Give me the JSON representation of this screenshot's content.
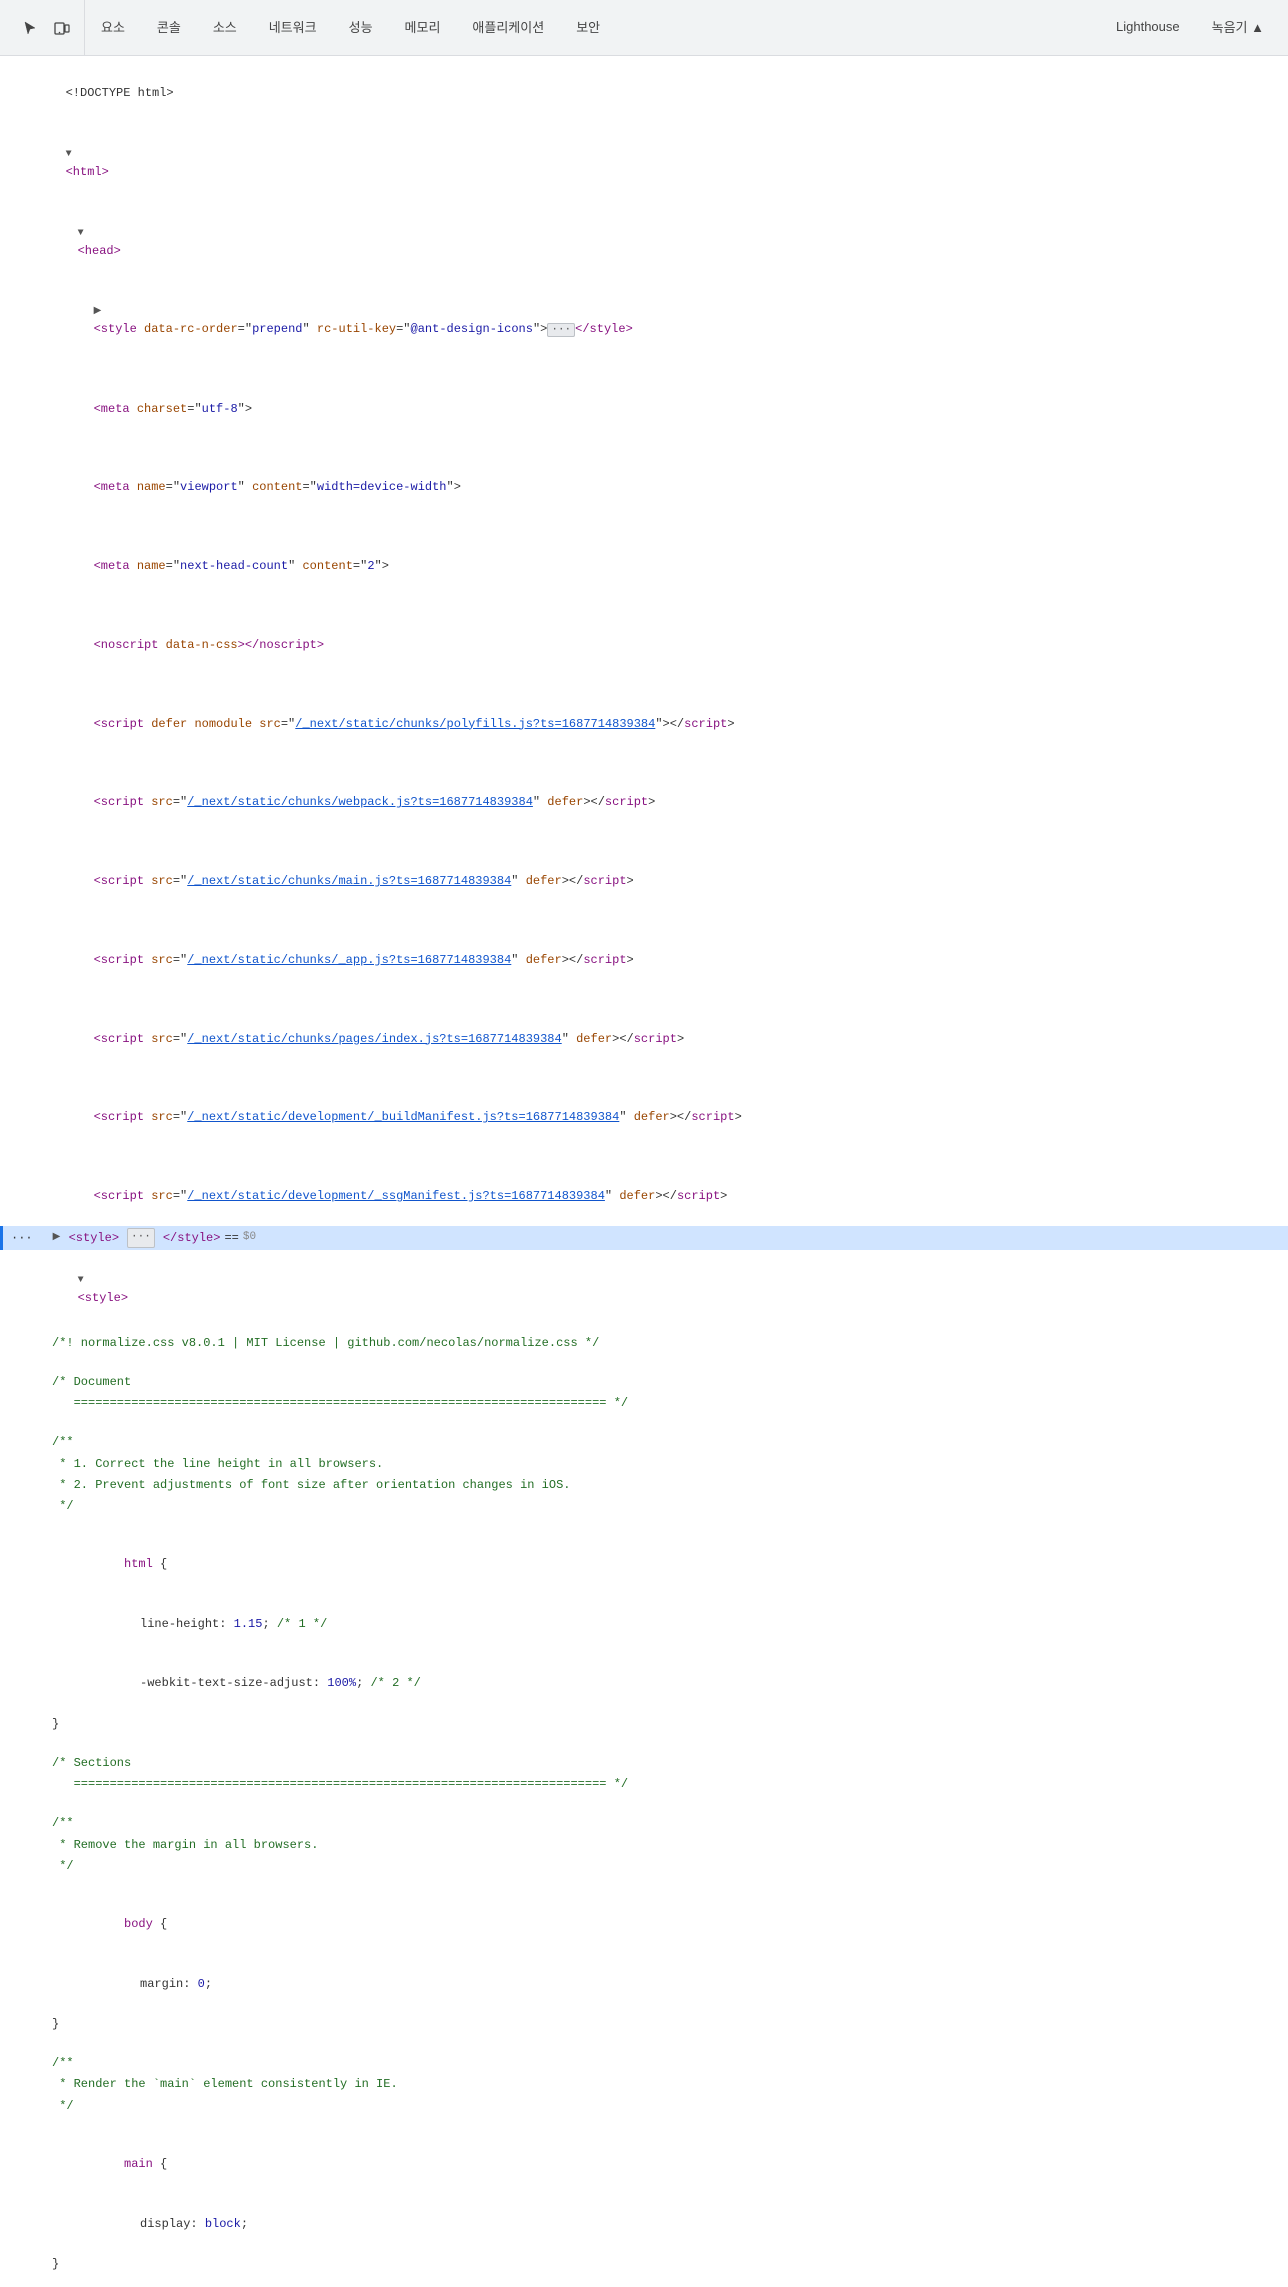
{
  "toolbar": {
    "icons": [
      {
        "name": "cursor-icon",
        "symbol": "↖",
        "label": "Inspect element"
      },
      {
        "name": "device-icon",
        "symbol": "⬜",
        "label": "Toggle device toolbar"
      }
    ],
    "tabs": [
      {
        "id": "elements",
        "label": "요소",
        "active": false
      },
      {
        "id": "console",
        "label": "콘솔",
        "active": false
      },
      {
        "id": "sources",
        "label": "소스",
        "active": false
      },
      {
        "id": "network",
        "label": "네트워크",
        "active": false
      },
      {
        "id": "performance",
        "label": "성능",
        "active": false
      },
      {
        "id": "memory",
        "label": "메모리",
        "active": false
      },
      {
        "id": "application",
        "label": "애플리케이션",
        "active": false
      },
      {
        "id": "security",
        "label": "보안",
        "active": false
      },
      {
        "id": "lighthouse",
        "label": "Lighthouse",
        "active": false
      },
      {
        "id": "record",
        "label": "녹음기 ▲",
        "active": false
      }
    ]
  },
  "dom": {
    "lines": [
      {
        "text": "<!DOCTYPE html>",
        "type": "plain",
        "indent": 0
      },
      {
        "text": "<html>",
        "type": "tag-open",
        "indent": 0
      },
      {
        "text": "<head>",
        "type": "tag-open-expand",
        "indent": 0,
        "expanded": true
      },
      {
        "text": "<style data-rc-order=\"prepend\" rc-util-key=\"@ant-design-icons\">",
        "type": "style-collapsed",
        "indent": 1
      },
      {
        "text": "<meta charset=\"utf-8\">",
        "type": "meta",
        "indent": 1
      },
      {
        "text": "<meta name=\"viewport\" content=\"width=device-width\">",
        "type": "meta",
        "indent": 1
      },
      {
        "text": "<meta name=\"next-head-count\" content=\"2\">",
        "type": "meta",
        "indent": 1
      },
      {
        "text": "<noscript data-n-css></noscript>",
        "type": "noscript",
        "indent": 1
      },
      {
        "text_parts": [
          "<script defer nomodule src=\"",
          "/_next/static/chunks/polyfills.js?ts=1687714839384",
          "\"></",
          "script",
          ">"
        ],
        "type": "script-link",
        "indent": 1
      },
      {
        "text_parts": [
          "<script src=\"",
          "/_next/static/chunks/webpack.js?ts=1687714839384",
          "\" defer></",
          "script",
          ">"
        ],
        "type": "script-link",
        "indent": 1
      },
      {
        "text_parts": [
          "<script src=\"",
          "/_next/static/chunks/main.js?ts=1687714839384",
          "\" defer></",
          "script",
          ">"
        ],
        "type": "script-link",
        "indent": 1
      },
      {
        "text_parts": [
          "<script src=\"",
          "/_next/static/chunks/_app.js?ts=1687714839384",
          "\" defer></",
          "script",
          ">"
        ],
        "type": "script-link",
        "indent": 1
      },
      {
        "text_parts": [
          "<script src=\"",
          "/_next/static/chunks/pages/index.js?ts=1687714839384",
          "\" defer></",
          "script",
          ">"
        ],
        "type": "script-link",
        "indent": 1
      },
      {
        "text_parts": [
          "<script src=\"",
          "/_next/static/development/_buildManifest.js?ts=1687714839384",
          "\" defer></",
          "script",
          ">"
        ],
        "type": "script-link",
        "indent": 1
      },
      {
        "text_parts": [
          "<script src=\"",
          "/_next/static/development/_ssgManifest.js?ts=1687714839384",
          "\" defer></",
          "script",
          ">"
        ],
        "type": "script-link",
        "indent": 1
      }
    ],
    "selected_line": "<style> ··· </style> == $0",
    "css_content": [
      {
        "text": "/*! normalize.css v8.0.1 | MIT License | github.com/necolas/normalize.css */",
        "type": "comment"
      },
      {
        "text": "",
        "type": "blank"
      },
      {
        "text": "/* Document",
        "type": "comment"
      },
      {
        "text": "   ========================================================================== */",
        "type": "comment"
      },
      {
        "text": "",
        "type": "blank"
      },
      {
        "text": "/**",
        "type": "comment"
      },
      {
        "text": " * 1. Correct the line height in all browsers.",
        "type": "comment"
      },
      {
        "text": " * 2. Prevent adjustments of font size after orientation changes in iOS.",
        "type": "comment"
      },
      {
        "text": " */",
        "type": "comment"
      },
      {
        "text": "",
        "type": "blank"
      },
      {
        "text": "html {",
        "type": "selector"
      },
      {
        "text": "  line-height: 1.15; /* 1 */",
        "type": "property",
        "prop": "line-height",
        "value": "1.15",
        "comment": "/* 1 */"
      },
      {
        "text": "  -webkit-text-size-adjust: 100%; /* 2 */",
        "type": "property",
        "prop": "-webkit-text-size-adjust",
        "value": "100%",
        "comment": "/* 2 */"
      },
      {
        "text": "}",
        "type": "brace"
      },
      {
        "text": "",
        "type": "blank"
      },
      {
        "text": "/* Sections",
        "type": "comment"
      },
      {
        "text": "   ========================================================================== */",
        "type": "comment"
      },
      {
        "text": "",
        "type": "blank"
      },
      {
        "text": "/**",
        "type": "comment"
      },
      {
        "text": " * Remove the margin in all browsers.",
        "type": "comment"
      },
      {
        "text": " */",
        "type": "comment"
      },
      {
        "text": "",
        "type": "blank"
      },
      {
        "text": "body {",
        "type": "selector"
      },
      {
        "text": "  margin: 0;",
        "type": "property",
        "prop": "margin",
        "value": "0"
      },
      {
        "text": "}",
        "type": "brace"
      },
      {
        "text": "",
        "type": "blank"
      },
      {
        "text": "/**",
        "type": "comment"
      },
      {
        "text": " * Render the `main` element consistently in IE.",
        "type": "comment"
      },
      {
        "text": " */",
        "type": "comment"
      },
      {
        "text": "",
        "type": "blank"
      },
      {
        "text": "main {",
        "type": "selector"
      },
      {
        "text": "  display: block;",
        "type": "property",
        "prop": "display",
        "value": "block"
      },
      {
        "text": "}",
        "type": "brace"
      }
    ]
  },
  "colors": {
    "tag": "#881280",
    "attr_name": "#994500",
    "attr_value": "#1a1aa6",
    "link": "#1155cc",
    "comment": "#236e25",
    "selection_bg": "#d0e4ff",
    "toolbar_bg": "#f1f3f4",
    "number": "#1a1aa6"
  }
}
